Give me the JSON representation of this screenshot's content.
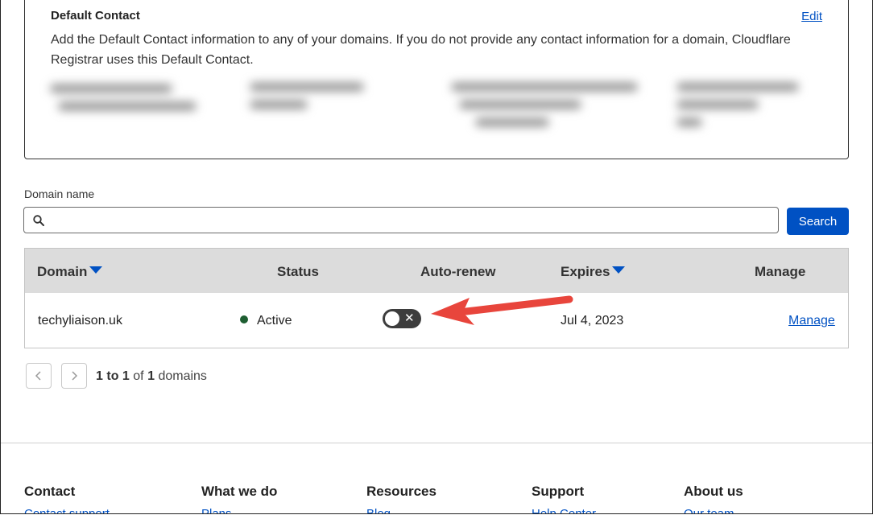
{
  "default_contact": {
    "title": "Default Contact",
    "edit_label": "Edit",
    "description": "Add the Default Contact information to any of your domains. If you do not provide any contact information for a domain, Cloudflare Registrar uses this Default Contact."
  },
  "search": {
    "label": "Domain name",
    "placeholder": "",
    "value": "",
    "button_label": "Search"
  },
  "table": {
    "headers": {
      "domain": "Domain",
      "status": "Status",
      "auto_renew": "Auto-renew",
      "expires": "Expires",
      "manage": "Manage"
    },
    "rows": [
      {
        "domain": "techyliaison.uk",
        "status": "Active",
        "auto_renew": "off",
        "expires": "Jul 4, 2023",
        "manage": "Manage"
      }
    ]
  },
  "pagination": {
    "from": "1",
    "to_word": "to",
    "to": "1",
    "of_word": "of",
    "total": "1",
    "unit": "domains"
  },
  "footer": {
    "columns": [
      {
        "title": "Contact",
        "first_link": "Contact support"
      },
      {
        "title": "What we do",
        "first_link": "Plans"
      },
      {
        "title": "Resources",
        "first_link": "Blog"
      },
      {
        "title": "Support",
        "first_link": "Help Center"
      },
      {
        "title": "About us",
        "first_link": "Our team"
      }
    ]
  },
  "colors": {
    "accent": "#0051c3",
    "status_active": "#1e5e32",
    "annotation_arrow": "#e8453c",
    "header_bg": "#dcdcdc"
  },
  "icons": [
    "search-icon",
    "sort-down-icon",
    "close-icon",
    "chevron-left-icon",
    "chevron-right-icon"
  ]
}
